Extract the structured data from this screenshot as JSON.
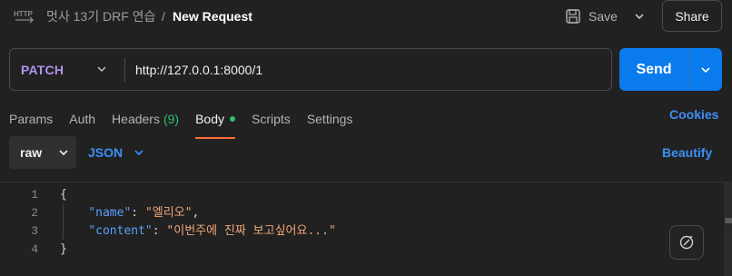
{
  "header": {
    "icon": "http-icon",
    "collection": "멋사 13기 DRF 연습",
    "separator": "/",
    "request_name": "New Request",
    "save_label": "Save",
    "share_label": "Share"
  },
  "request": {
    "method": "PATCH",
    "url": "http://127.0.0.1:8000/1",
    "send_label": "Send",
    "method_color": "#b392f0",
    "send_color": "#097bed"
  },
  "tabs": [
    {
      "label": "Params"
    },
    {
      "label": "Auth"
    },
    {
      "label": "Headers",
      "count": "(9)"
    },
    {
      "label": "Body",
      "active": true,
      "indicator": "green-dot"
    },
    {
      "label": "Scripts"
    },
    {
      "label": "Settings"
    }
  ],
  "cookies_label": "Cookies",
  "body_options": {
    "mode": "raw",
    "format": "JSON",
    "beautify_label": "Beautify"
  },
  "editor": {
    "line_numbers": [
      "1",
      "2",
      "3",
      "4"
    ],
    "open_brace": "{",
    "close_brace": "}",
    "fields": [
      {
        "key": "\"name\"",
        "value": "\"엘리오\"",
        "trailing": ","
      },
      {
        "key": "\"content\"",
        "value": "\"이번주에 진짜 보고싶어요...\"",
        "trailing": ""
      }
    ]
  },
  "accent_colors": {
    "active_tab_underline": "#ff6c37",
    "body_dot": "#2bc06c",
    "link_blue": "#3d8ef5",
    "json_key": "#5aa0f7",
    "json_string": "#f0a679"
  }
}
